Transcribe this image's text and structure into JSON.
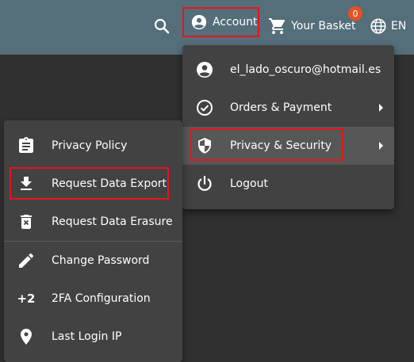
{
  "topbar": {
    "account_label": "Account",
    "basket_label": "Your Basket",
    "basket_count": "0",
    "language": "EN",
    "bar_color": "#546e7a",
    "badge_color": "#e6521f"
  },
  "account_menu": {
    "email": "el_lado_oscuro@hotmail.es",
    "orders": "Orders & Payment",
    "privacy": "Privacy & Security",
    "logout": "Logout"
  },
  "privacy_menu": {
    "policy": "Privacy Policy",
    "export": "Request Data Export",
    "erasure": "Request Data Erasure",
    "password": "Change Password",
    "twofa_icon": "+2",
    "twofa": "2FA Configuration",
    "last_login": "Last Login IP"
  },
  "highlight_color": "#e3151e"
}
